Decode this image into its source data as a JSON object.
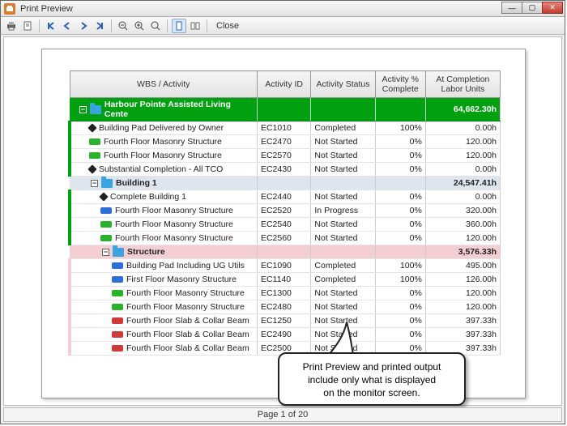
{
  "window": {
    "title": "Print Preview"
  },
  "toolbar": {
    "close": "Close"
  },
  "columns": {
    "wbs": "WBS / Activity",
    "id": "Activity ID",
    "status": "Activity Status",
    "pct": "Activity % Complete",
    "labor": "At Completion Labor Units"
  },
  "rows": [
    {
      "type": "band",
      "level": 0,
      "band": "green",
      "toggle": "-",
      "icon": "folder",
      "name": "Harbour Pointe Assisted Living Cente",
      "labor": "64,662.30h"
    },
    {
      "type": "data",
      "level": 1,
      "icon": "diamond",
      "name": "Building Pad Delivered by Owner",
      "id": "EC1010",
      "status": "Completed",
      "pct": "100%",
      "labor": "0.00h"
    },
    {
      "type": "data",
      "level": 1,
      "icon": "bar-green",
      "name": "Fourth Floor Masonry Structure",
      "id": "EC2470",
      "status": "Not Started",
      "pct": "0%",
      "labor": "120.00h"
    },
    {
      "type": "data",
      "level": 1,
      "icon": "bar-green",
      "name": "Fourth Floor Masonry Structure",
      "id": "EC2570",
      "status": "Not Started",
      "pct": "0%",
      "labor": "120.00h"
    },
    {
      "type": "data",
      "level": 1,
      "icon": "diamond",
      "name": "Substantial Completion - All TCO",
      "id": "EC2430",
      "status": "Not Started",
      "pct": "0%",
      "labor": "0.00h"
    },
    {
      "type": "band",
      "level": 1,
      "band": "blue",
      "toggle": "-",
      "icon": "folder",
      "name": "Building 1",
      "labor": "24,547.41h"
    },
    {
      "type": "data",
      "level": 2,
      "icon": "diamond",
      "name": "Complete Building 1",
      "id": "EC2440",
      "status": "Not Started",
      "pct": "0%",
      "labor": "0.00h"
    },
    {
      "type": "data",
      "level": 2,
      "icon": "bar-blue",
      "name": "Fourth Floor Masonry Structure",
      "id": "EC2520",
      "status": "In Progress",
      "pct": "0%",
      "labor": "320.00h"
    },
    {
      "type": "data",
      "level": 2,
      "icon": "bar-green",
      "name": "Fourth Floor Masonry Structure",
      "id": "EC2540",
      "status": "Not Started",
      "pct": "0%",
      "labor": "360.00h"
    },
    {
      "type": "data",
      "level": 2,
      "icon": "bar-green",
      "name": "Fourth Floor Masonry Structure",
      "id": "EC2560",
      "status": "Not Started",
      "pct": "0%",
      "labor": "120.00h"
    },
    {
      "type": "band",
      "level": 2,
      "band": "pink",
      "toggle": "-",
      "icon": "folder",
      "name": "Structure",
      "labor": "3,576.33h"
    },
    {
      "type": "data",
      "level": 3,
      "edge": "pink",
      "icon": "bar-blue",
      "name": "Building Pad Including UG Utils",
      "id": "EC1090",
      "status": "Completed",
      "pct": "100%",
      "labor": "495.00h"
    },
    {
      "type": "data",
      "level": 3,
      "edge": "pink",
      "icon": "bar-blue",
      "name": "First Floor Masonry Structure",
      "id": "EC1140",
      "status": "Completed",
      "pct": "100%",
      "labor": "126.00h"
    },
    {
      "type": "data",
      "level": 3,
      "edge": "pink",
      "icon": "bar-green",
      "name": "Fourth Floor Masonry Structure",
      "id": "EC1300",
      "status": "Not Started",
      "pct": "0%",
      "labor": "120.00h"
    },
    {
      "type": "data",
      "level": 3,
      "edge": "pink",
      "icon": "bar-green",
      "name": "Fourth Floor Masonry Structure",
      "id": "EC2480",
      "status": "Not Started",
      "pct": "0%",
      "labor": "120.00h"
    },
    {
      "type": "data",
      "level": 3,
      "edge": "pink",
      "icon": "bar-red",
      "name": "Fourth Floor Slab & Collar Beam",
      "id": "EC1250",
      "status": "Not Started",
      "pct": "0%",
      "labor": "397.33h"
    },
    {
      "type": "data",
      "level": 3,
      "edge": "pink",
      "icon": "bar-red",
      "name": "Fourth Floor Slab & Collar Beam",
      "id": "EC2490",
      "status": "Not Started",
      "pct": "0%",
      "labor": "397.33h"
    },
    {
      "type": "data",
      "level": 3,
      "edge": "pink",
      "icon": "bar-red",
      "name": "Fourth Floor Slab & Collar Beam",
      "id": "EC2500",
      "status": "Not Started",
      "pct": "0%",
      "labor": "397.33h"
    }
  ],
  "callout": {
    "line1": "Print Preview and printed output",
    "line2": "include only what is displayed",
    "line3": "on the monitor screen."
  },
  "status": {
    "page": "Page 1 of 20"
  }
}
